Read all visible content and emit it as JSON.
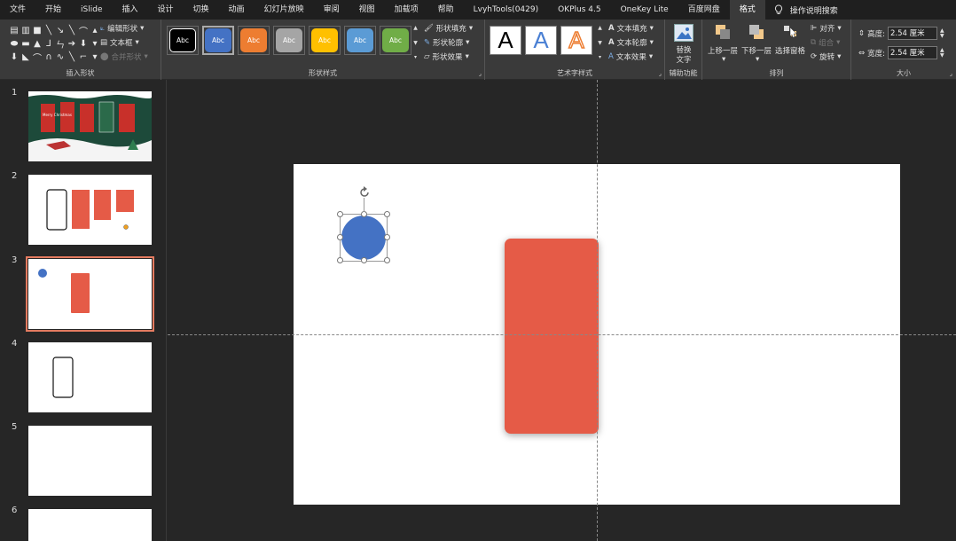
{
  "menu": {
    "tabs": [
      "文件",
      "开始",
      "iSlide",
      "插入",
      "设计",
      "切换",
      "动画",
      "幻灯片放映",
      "审阅",
      "视图",
      "加载项",
      "帮助",
      "LvyhTools(0429)",
      "OKPlus 4.5",
      "OneKey Lite",
      "百度网盘",
      "格式"
    ],
    "active": "格式",
    "search_label": "操作说明搜索"
  },
  "ribbon": {
    "insert_shapes": {
      "label": "插入形状",
      "edit_shape": "编辑形状",
      "text_box": "文本框",
      "merge_shapes": "合并形状"
    },
    "shape_styles": {
      "label": "形状样式",
      "swatch_text": "Abc",
      "swatches": [
        {
          "bg": "#000000",
          "fg": "#ffffff",
          "border": "#ffffff"
        },
        {
          "bg": "#4472c4",
          "fg": "#ffffff",
          "border": "#4472c4"
        },
        {
          "bg": "#ed7d31",
          "fg": "#ffffff",
          "border": "#ed7d31"
        },
        {
          "bg": "#a5a5a5",
          "fg": "#ffffff",
          "border": "#a5a5a5"
        },
        {
          "bg": "#ffc000",
          "fg": "#ffffff",
          "border": "#ffc000"
        },
        {
          "bg": "#5b9bd5",
          "fg": "#ffffff",
          "border": "#5b9bd5"
        },
        {
          "bg": "#70ad47",
          "fg": "#ffffff",
          "border": "#70ad47"
        }
      ],
      "fill": "形状填充",
      "outline": "形状轮廓",
      "effect": "形状效果"
    },
    "wordart": {
      "label": "艺术字样式",
      "sample": "A",
      "text_fill": "文本填充",
      "text_outline": "文本轮廓",
      "text_effect": "文本效果"
    },
    "accessibility": {
      "label": "辅助功能",
      "alt_text_line1": "替换",
      "alt_text_line2": "文字"
    },
    "arrange": {
      "label": "排列",
      "bring_forward": "上移一层",
      "send_backward": "下移一层",
      "selection_pane": "选择窗格",
      "align": "对齐",
      "group": "组合",
      "rotate": "旋转"
    },
    "size": {
      "label": "大小",
      "height_label": "高度:",
      "height_value": "2.54 厘米",
      "width_label": "宽度:",
      "width_value": "2.54 厘米"
    }
  },
  "slides": {
    "numbers": [
      "1",
      "2",
      "3",
      "4",
      "5",
      "6"
    ],
    "thumb1_title": "Merry Christmas",
    "selected": "3"
  },
  "colors": {
    "accent_red": "#e55b47",
    "accent_blue": "#4472c4",
    "selection_outline": "#e47b60"
  }
}
